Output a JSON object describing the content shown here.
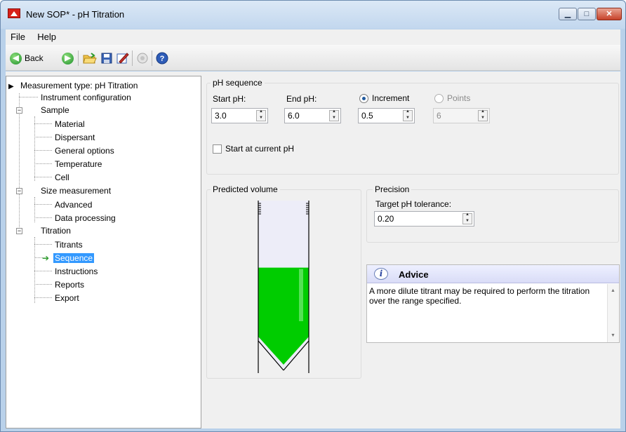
{
  "window": {
    "title": "New SOP* - pH Titration"
  },
  "controls": {
    "minimize": "▁",
    "maximize": "□",
    "close": "✕"
  },
  "menu": {
    "file": "File",
    "help": "Help"
  },
  "toolbar": {
    "back": "Back",
    "forward_icon": "arrow-right-icon",
    "open_icon": "folder-open-icon",
    "save_icon": "save-icon",
    "edit_icon": "edit-icon",
    "disabled_icon": "disabled-icon",
    "help_icon": "help-icon"
  },
  "tree": {
    "root": "Measurement type: pH Titration",
    "instrument": "Instrument configuration",
    "sample": "Sample",
    "material": "Material",
    "dispersant": "Dispersant",
    "general": "General options",
    "temperature": "Temperature",
    "cell": "Cell",
    "size": "Size measurement",
    "advanced": "Advanced",
    "data_processing": "Data processing",
    "titration": "Titration",
    "titrants": "Titrants",
    "sequence": "Sequence",
    "instructions": "Instructions",
    "reports": "Reports",
    "export": "Export"
  },
  "ph_sequence": {
    "title": "pH sequence",
    "start_label": "Start pH:",
    "start_value": "3.0",
    "end_label": "End pH:",
    "end_value": "6.0",
    "increment_label": "Increment",
    "increment_value": "0.5",
    "points_label": "Points",
    "points_value": "6",
    "increment_selected": true,
    "start_current_label": "Start at current pH",
    "start_current_checked": false
  },
  "predicted_volume": {
    "title": "Predicted volume",
    "fill_fraction": 0.58,
    "fill_color": "#00cc00"
  },
  "precision": {
    "title": "Precision",
    "tolerance_label": "Target pH tolerance:",
    "tolerance_value": "0.20"
  },
  "advice": {
    "title": "Advice",
    "text": "A more dilute titrant may be required to perform the titration over the range specified."
  }
}
